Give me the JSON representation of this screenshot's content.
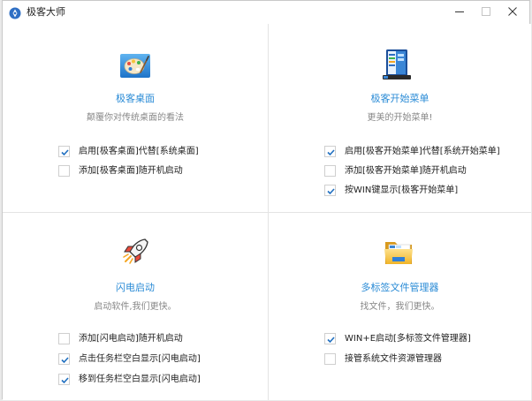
{
  "window": {
    "title": "极客大师",
    "accent": "#2a8bd6",
    "check_color": "#1f6fc0"
  },
  "features": [
    {
      "title": "极客桌面",
      "desc": "颠覆你对传统桌面的看法",
      "icon": "palette-icon",
      "options": [
        {
          "label": "启用[极客桌面]代替[系统桌面]",
          "checked": true
        },
        {
          "label": "添加[极客桌面]随开机启动",
          "checked": false
        }
      ]
    },
    {
      "title": "极客开始菜单",
      "desc": "更美的开始菜单!",
      "icon": "start-menu-icon",
      "options": [
        {
          "label": "启用[极客开始菜单]代替[系统开始菜单]",
          "checked": true
        },
        {
          "label": "添加[极客开始菜单]随开机启动",
          "checked": false
        },
        {
          "label": "按WIN键显示[极客开始菜单]",
          "checked": true
        }
      ]
    },
    {
      "title": "闪电启动",
      "desc": "启动软件,我们更快。",
      "icon": "rocket-icon",
      "options": [
        {
          "label": "添加[闪电启动]随开机启动",
          "checked": false
        },
        {
          "label": "点击任务栏空白显示[闪电启动]",
          "checked": true
        },
        {
          "label": "移到任务栏空白显示[闪电启动]",
          "checked": true
        }
      ]
    },
    {
      "title": "多标签文件管理器",
      "desc": "找文件，我们更快。",
      "icon": "folder-icon",
      "options": [
        {
          "label": "WIN+E启动[多标签文件管理器]",
          "checked": true
        },
        {
          "label": "接管系统文件资源管理器",
          "checked": false
        }
      ]
    }
  ]
}
